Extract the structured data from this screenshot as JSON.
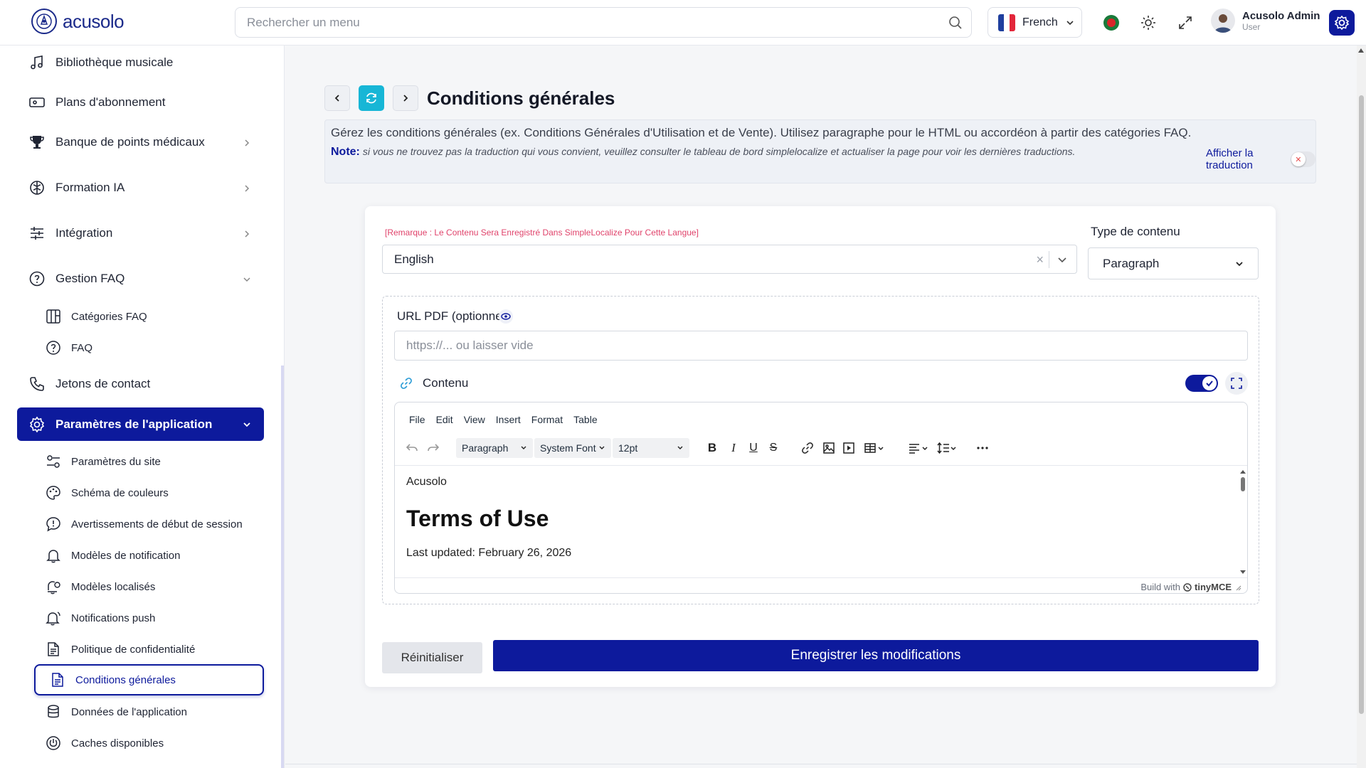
{
  "header": {
    "logo_text": "acusolo",
    "search_placeholder": "Rechercher un menu",
    "language": "French",
    "user_name": "Acusolo Admin",
    "user_role": "User",
    "brand_color": "#0d1a9c"
  },
  "sidebar": {
    "items": [
      {
        "label": "Bibliothèque musicale",
        "icon": "music-icon"
      },
      {
        "label": "Plans d'abonnement",
        "icon": "ticket-icon"
      },
      {
        "label": "Banque de points médicaux",
        "icon": "trophy-icon"
      },
      {
        "label": "Formation IA",
        "icon": "brain-icon"
      },
      {
        "label": "Intégration",
        "icon": "sliders-icon"
      },
      {
        "label": "Gestion FAQ",
        "icon": "help-circle-icon"
      },
      {
        "label": "Jetons de contact",
        "icon": "phone-icon"
      }
    ],
    "faq_sub": [
      {
        "label": "Catégories FAQ",
        "icon": "columns-icon"
      },
      {
        "label": "FAQ",
        "icon": "help-circle-icon"
      }
    ],
    "active_section": "Paramètres de l'application",
    "app_sub": [
      {
        "label": "Paramètres du site",
        "icon": "toggles-icon"
      },
      {
        "label": "Schéma de couleurs",
        "icon": "palette-icon"
      },
      {
        "label": "Avertissements de début de session",
        "icon": "alert-bubble-icon"
      },
      {
        "label": "Modèles de notification",
        "icon": "bell-icon"
      },
      {
        "label": "Modèles localisés",
        "icon": "bell-globe-icon"
      },
      {
        "label": "Notifications push",
        "icon": "bell-ring-icon"
      },
      {
        "label": "Politique de confidentialité",
        "icon": "document-icon"
      },
      {
        "label": "Conditions générales",
        "icon": "document-icon"
      },
      {
        "label": "Données de l'application",
        "icon": "database-icon"
      },
      {
        "label": "Caches disponibles",
        "icon": "power-icon"
      }
    ]
  },
  "page": {
    "title": "Conditions générales",
    "info_text": "Gérez les conditions générales (ex. Conditions Générales d'Utilisation et de Vente). Utilisez paragraphe pour le HTML ou accordéon à partir des catégories FAQ.",
    "note_label": "Note:",
    "note_text": "si vous ne trouvez pas la traduction qui vous convient, veuillez consulter le tableau de bord simplelocalize et actualiser la page pour voir les dernières traductions.",
    "translation_toggle_label": "Afficher la traduction"
  },
  "form": {
    "remark": "[Remarque : Le Contenu Sera Enregistré Dans SimpleLocalize Pour Cette Langue]",
    "language_value": "English",
    "content_type_label": "Type de contenu",
    "content_type_value": "Paragraph",
    "pdf_label": "URL PDF (optionnel)",
    "pdf_placeholder": "https://... ou laisser vide",
    "content_label": "Contenu",
    "reset_label": "Réinitialiser",
    "save_label": "Enregistrer les modifications"
  },
  "editor": {
    "menus": [
      "File",
      "Edit",
      "View",
      "Insert",
      "Format",
      "Table"
    ],
    "block_format": "Paragraph",
    "font_family": "System Font",
    "font_size": "12pt",
    "doc_brand": "Acusolo",
    "doc_title": "Terms of Use",
    "doc_date": "Last updated: February 26, 2026",
    "branding_prefix": "Build with",
    "branding_name": "tinyMCE"
  }
}
